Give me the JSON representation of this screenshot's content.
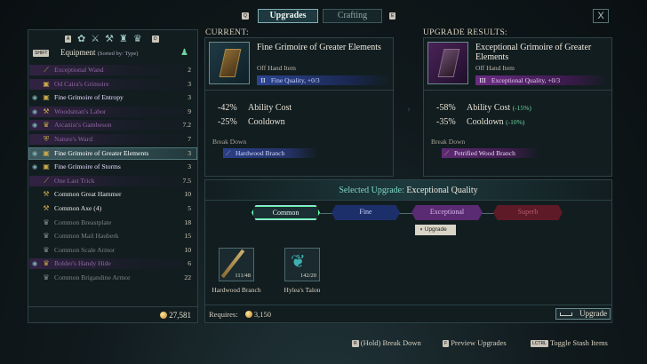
{
  "tabs": {
    "left_key": "Q",
    "upgrades": "Upgrades",
    "crafting": "Crafting",
    "right_key": "E",
    "close": "X"
  },
  "inventory": {
    "filter_keys": [
      "A",
      "D"
    ],
    "shift_key": "SHIFT",
    "header": "Equipment",
    "sort": "(Sorted by: Type)",
    "gold": "27,581",
    "items": [
      {
        "name": "Exceptional Wand",
        "count": "2",
        "rarity": "purple",
        "icon": "wand-icon"
      },
      {
        "name": "Od Caira's Grimoire",
        "count": "3",
        "rarity": "purple",
        "icon": "grimoire-icon"
      },
      {
        "name": "Fine Grimoire of Entropy",
        "count": "3",
        "rarity": "bright",
        "icon": "grimoire-icon"
      },
      {
        "name": "Woodsman's Labor",
        "count": "9",
        "rarity": "purple",
        "icon": "axe-icon"
      },
      {
        "name": "Arcanist's Gambeson",
        "count": "7.2",
        "rarity": "purple",
        "icon": "armor-icon"
      },
      {
        "name": "Nature's Ward",
        "count": "7",
        "rarity": "purple",
        "icon": "shield-icon"
      },
      {
        "name": "Fine Grimoire of Greater Elements",
        "count": "3",
        "rarity": "sel",
        "icon": "grimoire-icon"
      },
      {
        "name": "Fine Grimoire of Storms",
        "count": "3",
        "rarity": "bright",
        "icon": "grimoire-icon"
      },
      {
        "name": "One Last Trick",
        "count": "7.5",
        "rarity": "purple",
        "icon": "dagger-icon"
      },
      {
        "name": "Common Great Hammer",
        "count": "10",
        "rarity": "white",
        "icon": "hammer-icon"
      },
      {
        "name": "Common Axe (4)",
        "count": "5",
        "rarity": "white",
        "icon": "axe-icon"
      },
      {
        "name": "Common Breastplate",
        "count": "18",
        "rarity": "grey",
        "icon": "armor-icon"
      },
      {
        "name": "Common Mail Hauberk",
        "count": "15",
        "rarity": "grey",
        "icon": "armor-icon"
      },
      {
        "name": "Common Scale Armor",
        "count": "10",
        "rarity": "grey",
        "icon": "armor-icon"
      },
      {
        "name": "Bolder's Handy Hide",
        "count": "6",
        "rarity": "purple",
        "icon": "armor-icon"
      },
      {
        "name": "Common Brigandine Armor",
        "count": "22",
        "rarity": "grey",
        "icon": "armor-icon"
      }
    ]
  },
  "current": {
    "label": "CURRENT:",
    "title": "Fine Grimoire of Greater Elements",
    "type": "Off Hand Item",
    "quality_numeral": "II",
    "quality": "Fine Quality, +0/3",
    "stats": [
      {
        "value": "-42%",
        "name": "Ability Cost"
      },
      {
        "value": "-25%",
        "name": "Cooldown"
      }
    ],
    "breakdown_label": "Break Down",
    "breakdown_item": "Hardwood Branch"
  },
  "results": {
    "label": "UPGRADE RESULTS:",
    "title": "Exceptional Grimoire of Greater Elements",
    "type": "Off Hand Item",
    "quality_numeral": "III",
    "quality": "Exceptional Quality, +0/3",
    "stats": [
      {
        "value": "-58%",
        "name": "Ability Cost",
        "delta": "(-15%)"
      },
      {
        "value": "-35%",
        "name": "Cooldown",
        "delta": "(-10%)"
      }
    ],
    "breakdown_label": "Break Down",
    "breakdown_item": "Petrified Wood Branch"
  },
  "upgrade": {
    "selected_label": "Selected Upgrade:",
    "selected_value": "Exceptional Quality",
    "tiers": [
      "Common",
      "Fine",
      "Exceptional",
      "Superb"
    ],
    "tooltip_key": "Upgrade",
    "materials": [
      {
        "name": "Hardwood Branch",
        "qty": "111/48"
      },
      {
        "name": "Hylea's Talon",
        "qty": "142/20"
      }
    ],
    "requires_label": "Requires:",
    "cost": "3,150",
    "button": "Upgrade"
  },
  "footer": [
    {
      "key": "R",
      "label": "(Hold) Break Down"
    },
    {
      "key": "F",
      "label": "Preview Upgrades"
    },
    {
      "key": "LCTRL",
      "label": "Toggle Stash Items"
    }
  ],
  "colors": {
    "accent": "#7fb0b5",
    "fine": "#4a6cd1",
    "exceptional": "#8a3fb0",
    "superb": "#8a2030",
    "gold": "#d8a53a"
  }
}
